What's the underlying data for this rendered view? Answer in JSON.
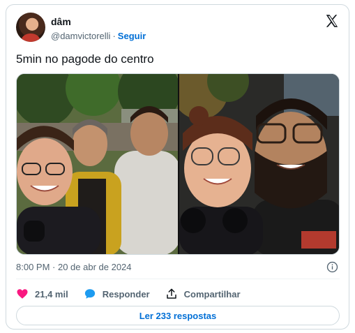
{
  "author": {
    "name": "dâm",
    "handle": "@damvictorelli",
    "separator": "·",
    "follow_label": "Seguir"
  },
  "tweet": {
    "text": "5min no pagode do centro",
    "timestamp": "8:00 PM · 20 de abr de 2024"
  },
  "actions": {
    "likes": "21,4 mil",
    "reply_label": "Responder",
    "share_label": "Compartilhar"
  },
  "replies_button": "Ler 233 respostas",
  "icons": {
    "brand": "x-logo-icon",
    "like": "heart-icon",
    "reply": "speech-bubble-icon",
    "share": "share-upload-icon",
    "info": "info-icon"
  },
  "colors": {
    "link": "#006fd6",
    "like": "#f91880",
    "reply": "#1d9bf0",
    "muted": "#536471",
    "border": "#cfd9de"
  }
}
